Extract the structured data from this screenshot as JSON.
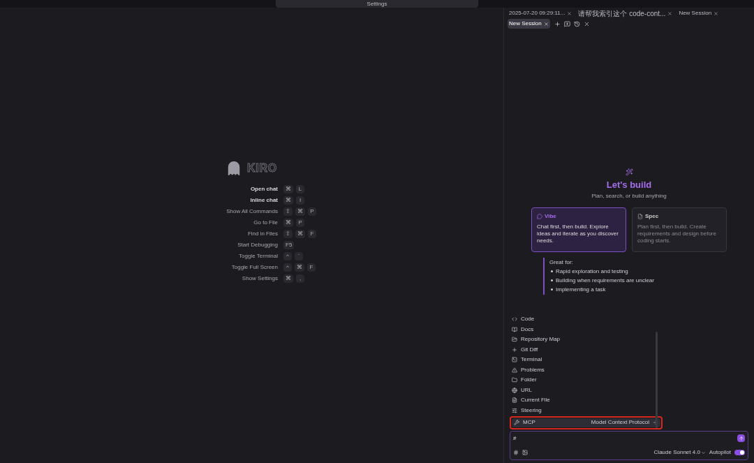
{
  "title_bar": {
    "search": "Settings"
  },
  "editor": {
    "logo": "KIRO",
    "shortcuts": [
      {
        "label": "Open chat",
        "bold": true,
        "keys": [
          "⌘",
          "L"
        ]
      },
      {
        "label": "Inline chat",
        "bold": true,
        "keys": [
          "⌘",
          "I"
        ]
      },
      {
        "label": "Show All Commands",
        "bold": false,
        "keys": [
          "⇧",
          "⌘",
          "P"
        ]
      },
      {
        "label": "Go to File",
        "bold": false,
        "keys": [
          "⌘",
          "P"
        ]
      },
      {
        "label": "Find in Files",
        "bold": false,
        "keys": [
          "⇧",
          "⌘",
          "F"
        ]
      },
      {
        "label": "Start Debugging",
        "bold": false,
        "keys": [
          "F5"
        ]
      },
      {
        "label": "Toggle Terminal",
        "bold": false,
        "keys": [
          "^",
          "`"
        ]
      },
      {
        "label": "Toggle Full Screen",
        "bold": false,
        "keys": [
          "^",
          "⌘",
          "F"
        ]
      },
      {
        "label": "Show Settings",
        "bold": false,
        "keys": [
          "⌘",
          ","
        ]
      }
    ]
  },
  "chat": {
    "tabs": [
      {
        "label": "2025-07-20 09:29:11...",
        "selected": false
      },
      {
        "label": "请帮我索引这个 code-cont...",
        "selected": false
      },
      {
        "label": "New Session",
        "selected": false
      },
      {
        "label": "New Session",
        "selected": true
      }
    ],
    "heading": "Let's build",
    "subheading": "Plan, search, or build anything",
    "modes": [
      {
        "kind": "vibe",
        "title": "Vibe",
        "description": "Chat first, then build. Explore ideas and iterate as you discover needs.",
        "selected": true
      },
      {
        "kind": "spec",
        "title": "Spec",
        "description": "Plan first, then build. Create requirements and design before coding starts.",
        "selected": false
      }
    ],
    "great_for": {
      "title": "Great for:",
      "items": [
        "Rapid exploration and testing",
        "Building when requirements are unclear",
        "Implementing a task"
      ]
    },
    "context_menu": [
      {
        "kind": "code",
        "label": "Code",
        "selected": false
      },
      {
        "kind": "docs",
        "label": "Docs",
        "selected": false
      },
      {
        "kind": "repo",
        "label": "Repository Map",
        "selected": false
      },
      {
        "kind": "diff",
        "label": "Git Diff",
        "selected": false
      },
      {
        "kind": "terminal",
        "label": "Terminal",
        "selected": false
      },
      {
        "kind": "problems",
        "label": "Problems",
        "selected": false
      },
      {
        "kind": "folder",
        "label": "Folder",
        "selected": false
      },
      {
        "kind": "url",
        "label": "URL",
        "selected": false
      },
      {
        "kind": "file",
        "label": "Current File",
        "selected": false
      },
      {
        "kind": "steering",
        "label": "Steering",
        "selected": false
      },
      {
        "kind": "mcp",
        "label": "MCP",
        "detail": "Model Context Protocol",
        "selected": true,
        "annotated": true
      }
    ],
    "input": {
      "value": "#"
    },
    "model": "Claude Sonnet 4.0",
    "autopilot": {
      "label": "Autopilot",
      "on": true
    }
  }
}
